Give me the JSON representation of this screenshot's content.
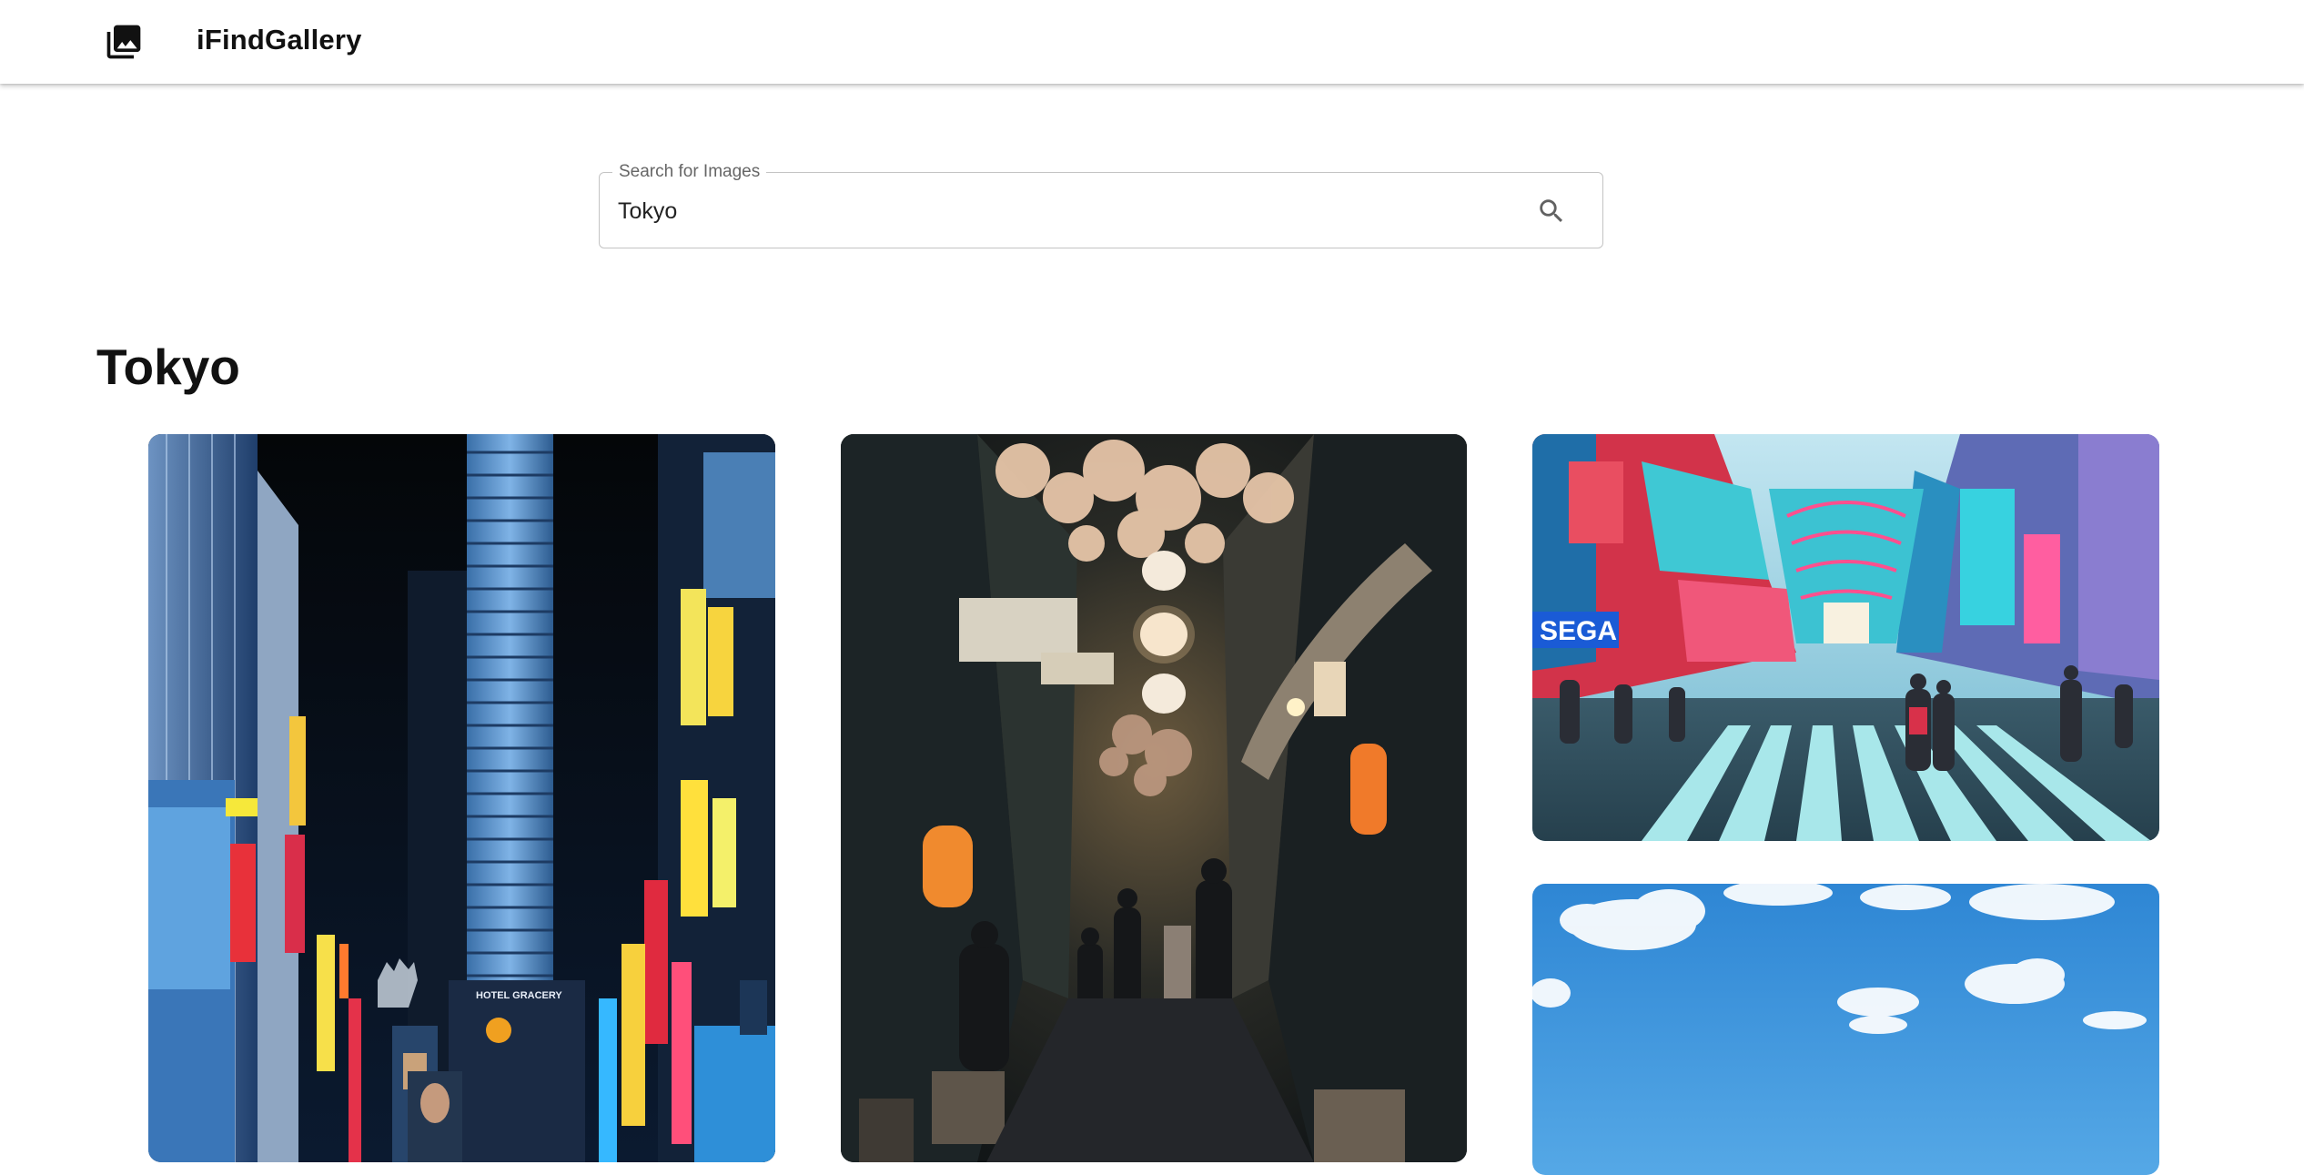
{
  "app": {
    "title": "iFindGallery",
    "logo_icon": "photo-library-icon"
  },
  "search": {
    "label": "Search for Images",
    "value": "Tokyo",
    "icon": "search-icon"
  },
  "results": {
    "heading": "Tokyo",
    "images": [
      {
        "scene": "neon-street-night-shinjuku",
        "text": "HOTEL GRACERY"
      },
      {
        "scene": "lantern-alley-omoide-yokocho",
        "text": ""
      },
      {
        "scene": "akihabara-crosswalk-neon",
        "text": "SEGA"
      },
      {
        "scene": "blue-sky-clouds",
        "text": ""
      }
    ]
  },
  "colors": {
    "appbar_bg": "#ffffff",
    "text": "#111111",
    "field_border": "#c4c4c4",
    "label": "#666666"
  }
}
